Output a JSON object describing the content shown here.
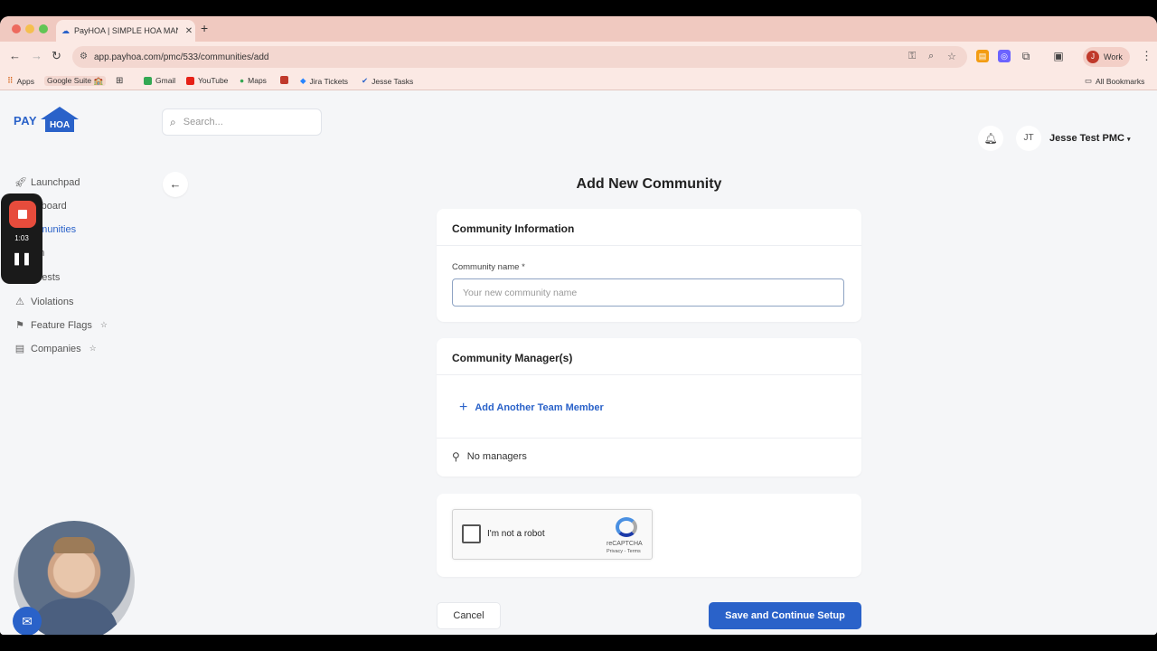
{
  "browser": {
    "tab_title": "PayHOA | SIMPLE HOA MANA",
    "url": "app.payhoa.com/pmc/533/communities/add",
    "profile_label": "Work",
    "profile_initial": "J",
    "bookmarks": [
      "Apps",
      "Google Suite 🏫",
      "Gmail",
      "YouTube",
      "Maps",
      "Jira Tickets",
      "Jesse Tasks"
    ],
    "all_bookmarks": "All Bookmarks"
  },
  "app": {
    "logo_pay": "PAY",
    "logo_hoa": "HOA",
    "search_placeholder": "Search...",
    "sidebar": [
      {
        "label": "Launchpad",
        "icon": "rocket-icon"
      },
      {
        "label": "shboard",
        "icon": "dashboard-icon"
      },
      {
        "label": "mmunities",
        "icon": "building-icon",
        "active": true
      },
      {
        "label": "am",
        "icon": "team-icon"
      },
      {
        "label": "quests",
        "icon": "requests-icon"
      },
      {
        "label": "Violations",
        "icon": "warning-icon"
      },
      {
        "label": "Feature Flags",
        "icon": "flag-icon",
        "starred": true
      },
      {
        "label": "Companies",
        "icon": "companies-icon",
        "starred": true
      }
    ],
    "recorder_time": "1:03",
    "user_initials": "JT",
    "user_name": "Jesse Test PMC"
  },
  "form": {
    "title": "Add New Community",
    "community_info_heading": "Community Information",
    "community_name_label": "Community name *",
    "community_name_placeholder": "Your new community name",
    "community_name_value": "",
    "managers_heading": "Community Manager(s)",
    "add_member_label": "Add Another Team Member",
    "no_managers_label": "No managers",
    "captcha_label": "I'm not a robot",
    "captcha_brand": "reCAPTCHA",
    "captcha_terms": "Privacy - Terms",
    "cancel_label": "Cancel",
    "save_label": "Save and Continue Setup"
  },
  "colors": {
    "accent": "#2a62c9",
    "recorder_stop": "#e74c3c"
  }
}
